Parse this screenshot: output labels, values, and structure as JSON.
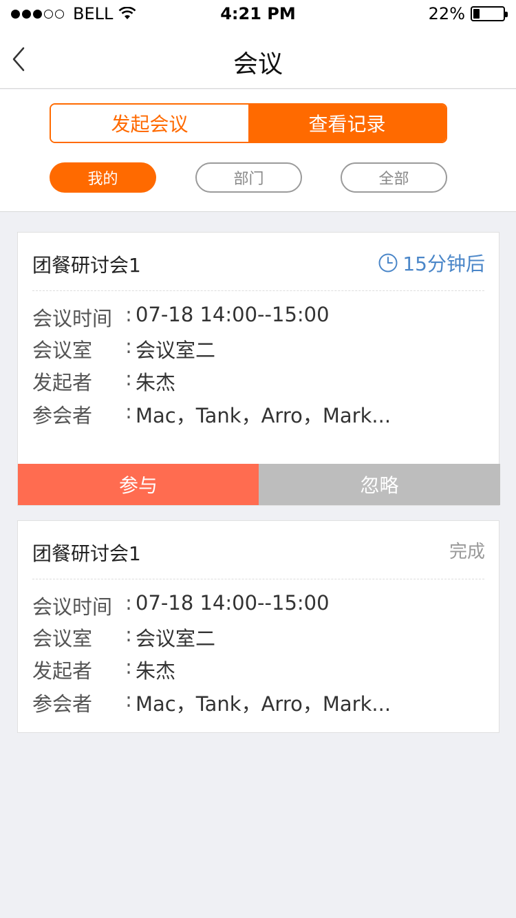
{
  "status_bar": {
    "carrier": "BELL",
    "time": "4:21 PM",
    "battery": "22%",
    "battery_level": 0.22
  },
  "nav": {
    "title": "会议",
    "back_icon": "chevron-left-icon"
  },
  "segments": {
    "start": "发起会议",
    "records": "查看记录",
    "active": "records"
  },
  "filters": {
    "mine": "我的",
    "department": "部门",
    "all": "全部",
    "active": "mine"
  },
  "colors": {
    "accent": "#ff6a00",
    "join": "#ff6c50",
    "ignore": "#bdbdbd",
    "countdown": "#4a86c8"
  },
  "meetings": [
    {
      "title": "团餐研讨会1",
      "status": "15分钟后",
      "status_icon": "clock-icon",
      "time_label": "会议时间",
      "time_value": "07-18 14:00--15:00",
      "room_label": "会议室",
      "room_value": "会议室二",
      "initiator_label": "发起者",
      "initiator_value": "朱杰",
      "attendees_label": "参会者",
      "attendees_value": "Mac，Tank，Arro，Mark...",
      "join_label": "参与",
      "ignore_label": "忽略"
    },
    {
      "title": "团餐研讨会1",
      "status": "完成",
      "time_label": "会议时间",
      "time_value": "07-18 14:00--15:00",
      "room_label": "会议室",
      "room_value": "会议室二",
      "initiator_label": "发起者",
      "initiator_value": "朱杰",
      "attendees_label": "参会者",
      "attendees_value": "Mac，Tank，Arro，Mark..."
    }
  ]
}
